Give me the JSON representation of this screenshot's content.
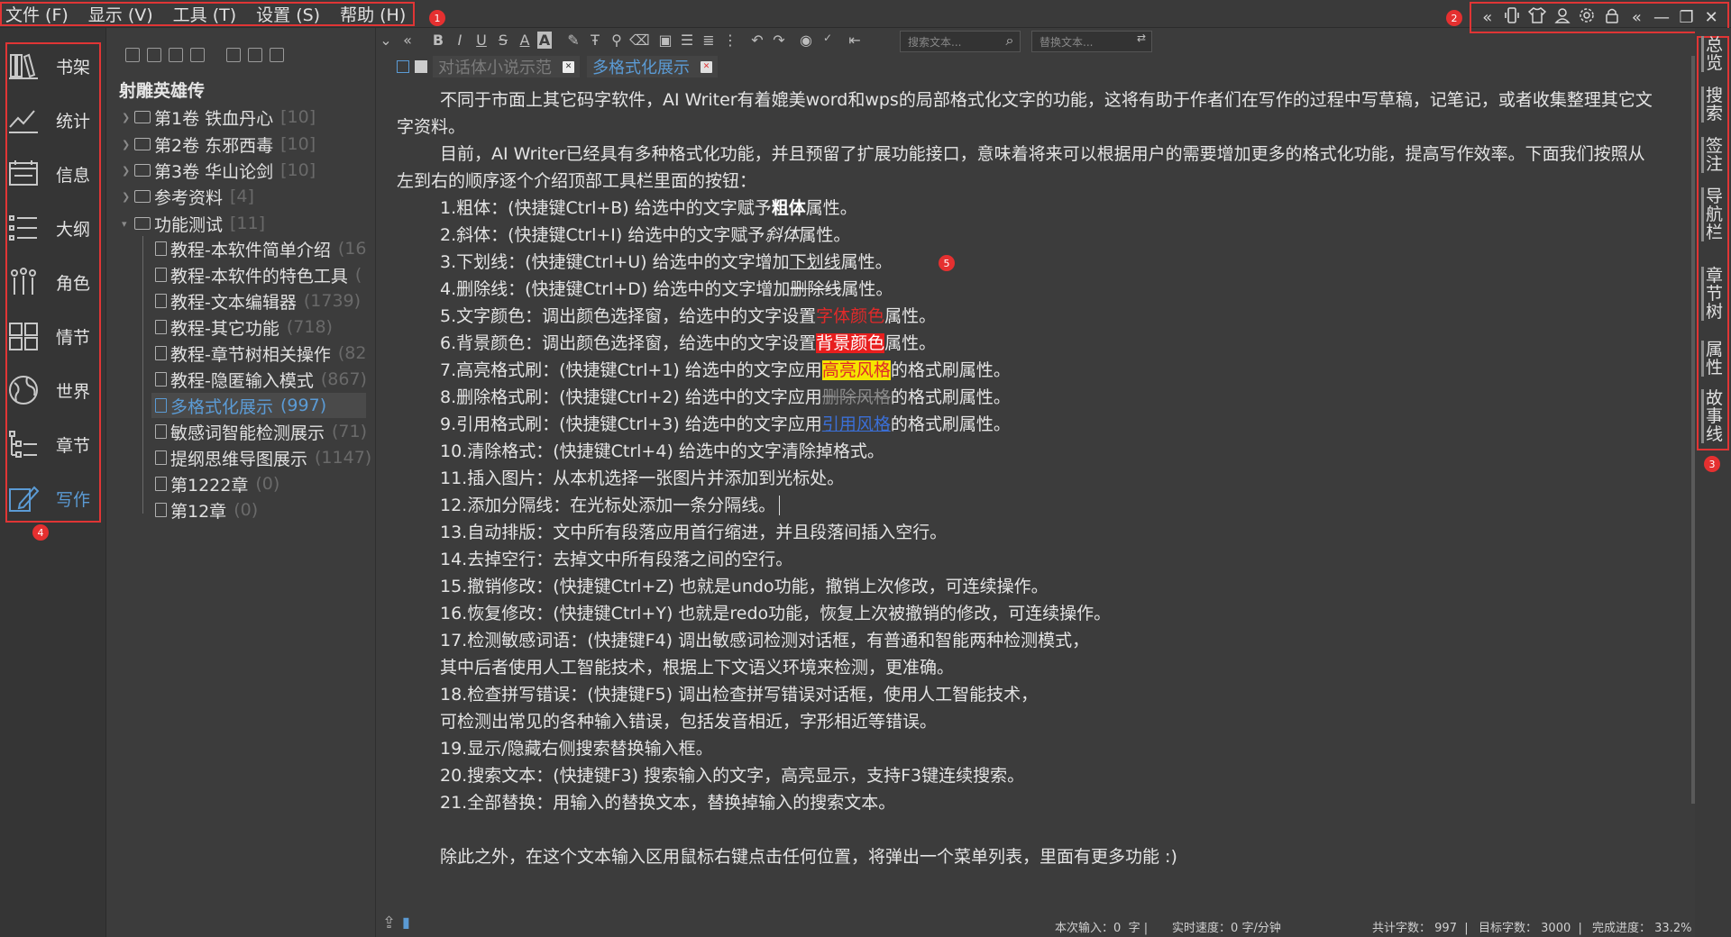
{
  "menu": {
    "items": [
      {
        "label": "文件 (F)"
      },
      {
        "label": "显示 (V)"
      },
      {
        "label": "工具 (T)"
      },
      {
        "label": "设置 (S)"
      },
      {
        "label": "帮助 (H)"
      }
    ]
  },
  "annotations": [
    "1",
    "2",
    "3",
    "4",
    "5"
  ],
  "window_icons": [
    "chevrons-left-icon",
    "phone-icon",
    "shirt-icon",
    "user-icon",
    "gear-icon",
    "lock-icon",
    "chevrons-left-icon",
    "minimize-icon",
    "restore-icon",
    "close-icon"
  ],
  "nav": {
    "items": [
      {
        "label": "书架",
        "icon": "bookshelf-icon"
      },
      {
        "label": "统计",
        "icon": "stats-icon"
      },
      {
        "label": "信息",
        "icon": "info-icon"
      },
      {
        "label": "大纲",
        "icon": "outline-icon"
      },
      {
        "label": "角色",
        "icon": "characters-icon"
      },
      {
        "label": "情节",
        "icon": "plot-icon"
      },
      {
        "label": "世界",
        "icon": "globe-icon"
      },
      {
        "label": "章节",
        "icon": "chapters-icon"
      },
      {
        "label": "写作",
        "icon": "write-icon",
        "active": true
      }
    ]
  },
  "tree": {
    "book_title": "射雕英雄传",
    "folders": [
      {
        "label": "第1卷 铁血丹心",
        "count": "[10]"
      },
      {
        "label": "第2卷 东邪西毒",
        "count": "[10]"
      },
      {
        "label": "第3卷 华山论剑",
        "count": "[10]"
      },
      {
        "label": "参考资料",
        "count": "[4]"
      },
      {
        "label": "功能测试",
        "count": "[11]"
      }
    ],
    "docs": [
      {
        "label": "教程-本软件简单介绍",
        "count": "(16"
      },
      {
        "label": "教程-本软件的特色工具",
        "count": "("
      },
      {
        "label": "教程-文本编辑器",
        "count": "(1739)"
      },
      {
        "label": "教程-其它功能",
        "count": "(718)"
      },
      {
        "label": "教程-章节树相关操作",
        "count": "(82"
      },
      {
        "label": "教程-隐匿输入模式",
        "count": "(867)"
      },
      {
        "label": "多格式化展示",
        "count": "(997)",
        "selected": true
      },
      {
        "label": "敏感词智能检测展示",
        "count": "(71)"
      },
      {
        "label": "提纲思维导图展示",
        "count": "(1147)"
      },
      {
        "label": "第1222章",
        "count": "(0)"
      },
      {
        "label": "第12章",
        "count": "(0)"
      }
    ]
  },
  "toolbar": {
    "search_placeholder": "搜索文本...",
    "replace_placeholder": "替换文本..."
  },
  "tabs": [
    {
      "label": "对话体小说示范",
      "active": false
    },
    {
      "label": "多格式化展示",
      "active": true
    }
  ],
  "editor": {
    "p1": "不同于市面上其它码字软件，AI Writer有着媲美word和wps的局部格式化文字的功能，这将有助于作者们在写作的过程中写草稿，记笔记，或者收集整理其它文",
    "p1b": "字资料。",
    "p2": "目前，AI Writer已经具有多种格式化功能，并且预留了扩展功能接口，意味着将来可以根据用户的需要增加更多的格式化功能，提高写作效率。下面我们按照从",
    "p2b": "左到右的顺序逐个介绍顶部工具栏里面的按钮：",
    "l1a": "1.粗体：(快捷键Ctrl+B) 给选中的文字赋予",
    "l1b": "粗体",
    "l1c": "属性。",
    "l2a": "2.斜体：(快捷键Ctrl+I) 给选中的文字赋予",
    "l2b": "斜体",
    "l2c": "属性。",
    "l3a": "3.下划线：(快捷键Ctrl+U) 给选中的文字增加",
    "l3b": "下划线",
    "l3c": "属性。",
    "l4a": "4.删除线：(快捷键Ctrl+D) 给选中的文字增加",
    "l4b": "删除线",
    "l4c": "属性。",
    "l5a": "5.文字颜色：调出颜色选择窗，给选中的文字设置",
    "l5b": "字体颜色",
    "l5c": "属性。",
    "l6a": "6.背景颜色：调出颜色选择窗，给选中的文字设置",
    "l6b": "背景颜色",
    "l6c": "属性。",
    "l7a": "7.高亮格式刷：(快捷键Ctrl+1) 给选中的文字应用",
    "l7b": "高亮风格",
    "l7c": "的格式刷属性。",
    "l8a": "8.删除格式刷：(快捷键Ctrl+2) 给选中的文字应用",
    "l8b": "删除风格",
    "l8c": "的格式刷属性。",
    "l9a": "9.引用格式刷：(快捷键Ctrl+3) 给选中的文字应用",
    "l9b": "引用风格",
    "l9c": "的格式刷属性。",
    "l10": "10.清除格式：(快捷键Ctrl+4) 给选中的文字清除掉格式。",
    "l11": "11.插入图片：从本机选择一张图片并添加到光标处。",
    "l12": "12.添加分隔线：在光标处添加一条分隔线。",
    "l13": "13.自动排版：文中所有段落应用首行缩进，并且段落间插入空行。",
    "l14": "14.去掉空行：去掉文中所有段落之间的空行。",
    "l15": "15.撤销修改：(快捷键Ctrl+Z) 也就是undo功能，撤销上次修改，可连续操作。",
    "l16": "16.恢复修改：(快捷键Ctrl+Y) 也就是redo功能，恢复上次被撤销的修改，可连续操作。",
    "l17a": "17.检测敏感词语：(快捷键F4) 调出敏感词检测对话框，有普通和智能两种检测模式，",
    "l17b": "其中后者使用人工智能技术，根据上下文语义环境来检测，更准确。",
    "l18a": "18.检查拼写错误：(快捷键F5) 调出检查拼写错误对话框，使用人工智能技术，",
    "l18b": "可检测出常见的各种输入错误，包括发音相近，字形相近等错误。",
    "l19": "19.显示/隐藏右侧搜索替换输入框。",
    "l20": "20.搜索文本：(快捷键F3) 搜索输入的文字，高亮显示，支持F3键连续搜索。",
    "l21": "21.全部替换：用输入的替换文本，替换掉输入的搜索文本。",
    "final": "除此之外，在这个文本输入区用鼠标右键点击任何位置，将弹出一个菜单列表，里面有更多功能 :)"
  },
  "right_rail": [
    {
      "label": "总览"
    },
    {
      "label": "搜索"
    },
    {
      "label": "签注"
    },
    {
      "label": "导航栏"
    },
    {
      "label": "章节树"
    },
    {
      "label": "属性"
    },
    {
      "label": "故事线"
    }
  ],
  "status": {
    "input_label": "本次输入：",
    "input_value": "0",
    "input_unit": "字",
    "speed_label": "实时速度：",
    "speed_value": "0",
    "speed_unit": "字/分钟",
    "total_label": "共计字数：",
    "total_value": "997",
    "target_label": "目标字数：",
    "target_value": "3000",
    "progress_label": "完成进度：",
    "progress_value": "33.2%"
  },
  "colors": {
    "accent": "#5b9bd5",
    "annotation_red": "#e53030",
    "background": "#3c3c3c"
  }
}
